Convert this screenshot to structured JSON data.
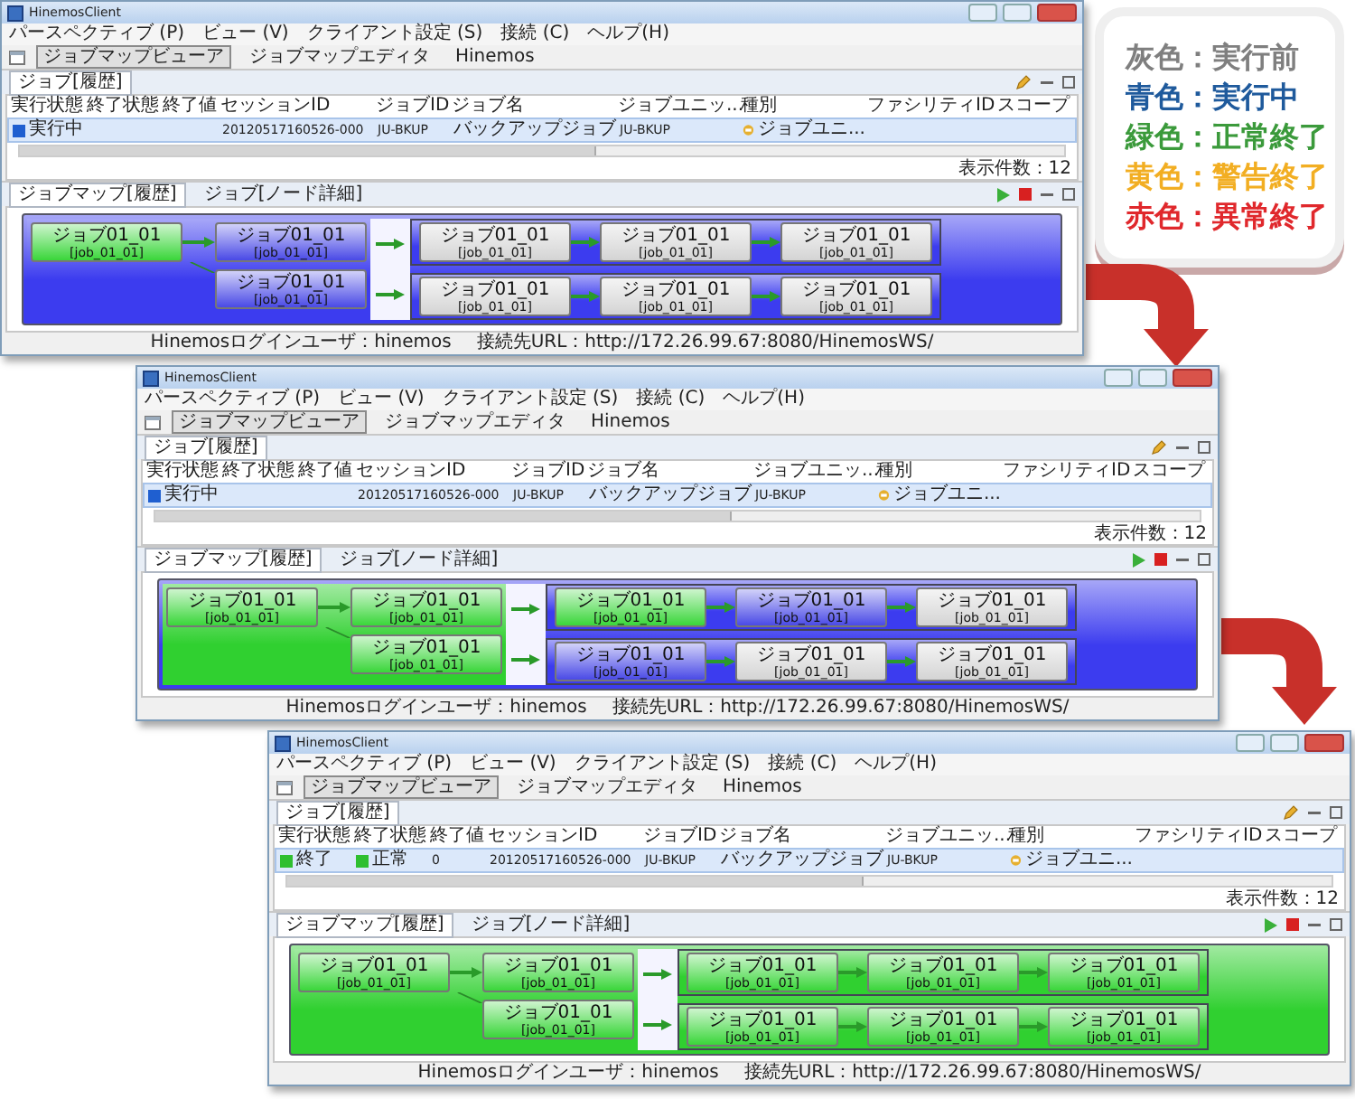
{
  "legend": [
    {
      "text": "灰色：実行前",
      "color": "#7f7f7f"
    },
    {
      "text": "青色：実行中",
      "color": "#1f5a9c"
    },
    {
      "text": "緑色：正常終了",
      "color": "#3b9a3b"
    },
    {
      "text": "黄色：警告終了",
      "color": "#f2ae22"
    },
    {
      "text": "赤色：異常終了",
      "color": "#e0282c"
    }
  ],
  "windows": [
    {
      "title": "HinemosClient",
      "menu": [
        "パースペクティブ (P)",
        "ビュー (V)",
        "クライアント設定 (S)",
        "接続 (C)",
        "ヘルプ(H)"
      ],
      "perspectives": [
        {
          "label": "ジョブマップビューア",
          "selected": true
        },
        {
          "label": "ジョブマップエディタ",
          "selected": false
        },
        {
          "label": "Hinemos",
          "selected": false
        }
      ],
      "history_tab": "ジョブ[履歴]",
      "columns": [
        "実行状態",
        "終了状態",
        "終了値",
        "セッションID",
        "ジョブID",
        "ジョブ名",
        "ジョブユニッ...",
        "種別",
        "ファシリティID",
        "スコープ"
      ],
      "row": {
        "run_state": {
          "text": "実行中",
          "color": "#1f5fd0"
        },
        "session_id": "20120517160526-000",
        "job_id": "JU-BKUP",
        "job_name": "バックアップジョブ",
        "jobunit_id": "JU-BKUP",
        "type": "ジョブユニ..."
      },
      "count": "表示件数：12",
      "map_tabs": [
        {
          "label": "ジョブマップ[履歴]",
          "selected": true
        },
        {
          "label": "ジョブ[ノード詳細]",
          "selected": false
        }
      ],
      "map": {
        "color": "#3c3cef",
        "left": {
          "color": "#3c3cef",
          "nodes": [
            {
              "label": "ジョブ01_01",
              "id": "[job_01_01]",
              "color": "#3ad63a"
            },
            {
              "label": "ジョブ01_01",
              "id": "[job_01_01]",
              "color": "#4a4ae6"
            },
            {
              "label": "ジョブ01_01",
              "id": "[job_01_01]",
              "color": "#4a4ae6"
            }
          ]
        },
        "groups": [
          {
            "color": "#3c3cef",
            "nodes": [
              {
                "label": "ジョブ01_01",
                "id": "[job_01_01]",
                "color": "#d4d4d4"
              },
              {
                "label": "ジョブ01_01",
                "id": "[job_01_01]",
                "color": "#d4d4d4"
              },
              {
                "label": "ジョブ01_01",
                "id": "[job_01_01]",
                "color": "#d4d4d4"
              }
            ]
          },
          {
            "color": "#3c3cef",
            "nodes": [
              {
                "label": "ジョブ01_01",
                "id": "[job_01_01]",
                "color": "#d4d4d4"
              },
              {
                "label": "ジョブ01_01",
                "id": "[job_01_01]",
                "color": "#d4d4d4"
              },
              {
                "label": "ジョブ01_01",
                "id": "[job_01_01]",
                "color": "#d4d4d4"
              }
            ]
          }
        ]
      },
      "status_user": "Hinemosログインユーザ：hinemos",
      "status_url": "接続先URL：http://172.26.99.67:8080/HinemosWS/"
    },
    {
      "title": "HinemosClient",
      "menu": [
        "パースペクティブ (P)",
        "ビュー (V)",
        "クライアント設定 (S)",
        "接続 (C)",
        "ヘルプ(H)"
      ],
      "perspectives": [
        {
          "label": "ジョブマップビューア",
          "selected": true
        },
        {
          "label": "ジョブマップエディタ",
          "selected": false
        },
        {
          "label": "Hinemos",
          "selected": false
        }
      ],
      "history_tab": "ジョブ[履歴]",
      "columns": [
        "実行状態",
        "終了状態",
        "終了値",
        "セッションID",
        "ジョブID",
        "ジョブ名",
        "ジョブユニッ...",
        "種別",
        "ファシリティID",
        "スコープ"
      ],
      "row": {
        "run_state": {
          "text": "実行中",
          "color": "#1f5fd0"
        },
        "session_id": "20120517160526-000",
        "job_id": "JU-BKUP",
        "job_name": "バックアップジョブ",
        "jobunit_id": "JU-BKUP",
        "type": "ジョブユニ..."
      },
      "count": "表示件数：12",
      "map_tabs": [
        {
          "label": "ジョブマップ[履歴]",
          "selected": true
        },
        {
          "label": "ジョブ[ノード詳細]",
          "selected": false
        }
      ],
      "map": {
        "color": "#3c3cef",
        "left": {
          "color": "#30d030",
          "nodes": [
            {
              "label": "ジョブ01_01",
              "id": "[job_01_01]",
              "color": "#3ad63a"
            },
            {
              "label": "ジョブ01_01",
              "id": "[job_01_01]",
              "color": "#3ad63a"
            },
            {
              "label": "ジョブ01_01",
              "id": "[job_01_01]",
              "color": "#3ad63a"
            }
          ]
        },
        "groups": [
          {
            "color": "#3c3cef",
            "nodes": [
              {
                "label": "ジョブ01_01",
                "id": "[job_01_01]",
                "color": "#3ad63a"
              },
              {
                "label": "ジョブ01_01",
                "id": "[job_01_01]",
                "color": "#4a4ae6"
              },
              {
                "label": "ジョブ01_01",
                "id": "[job_01_01]",
                "color": "#d4d4d4"
              }
            ]
          },
          {
            "color": "#3c3cef",
            "nodes": [
              {
                "label": "ジョブ01_01",
                "id": "[job_01_01]",
                "color": "#4a4ae6"
              },
              {
                "label": "ジョブ01_01",
                "id": "[job_01_01]",
                "color": "#d4d4d4"
              },
              {
                "label": "ジョブ01_01",
                "id": "[job_01_01]",
                "color": "#d4d4d4"
              }
            ]
          }
        ]
      },
      "status_user": "Hinemosログインユーザ：hinemos",
      "status_url": "接続先URL：http://172.26.99.67:8080/HinemosWS/"
    },
    {
      "title": "HinemosClient",
      "menu": [
        "パースペクティブ (P)",
        "ビュー (V)",
        "クライアント設定 (S)",
        "接続 (C)",
        "ヘルプ(H)"
      ],
      "perspectives": [
        {
          "label": "ジョブマップビューア",
          "selected": true
        },
        {
          "label": "ジョブマップエディタ",
          "selected": false
        },
        {
          "label": "Hinemos",
          "selected": false
        }
      ],
      "history_tab": "ジョブ[履歴]",
      "columns": [
        "実行状態",
        "終了状態",
        "終了値",
        "セッションID",
        "ジョブID",
        "ジョブ名",
        "ジョブユニッ...",
        "種別",
        "ファシリティID",
        "スコープ"
      ],
      "row": {
        "run_state": {
          "text": "終了",
          "color": "#2fbf2f"
        },
        "end_state": {
          "text": "正常",
          "color": "#2fbf2f"
        },
        "end_value": "0",
        "session_id": "20120517160526-000",
        "job_id": "JU-BKUP",
        "job_name": "バックアップジョブ",
        "jobunit_id": "JU-BKUP",
        "type": "ジョブユニ..."
      },
      "count": "表示件数：12",
      "map_tabs": [
        {
          "label": "ジョブマップ[履歴]",
          "selected": true
        },
        {
          "label": "ジョブ[ノード詳細]",
          "selected": false
        }
      ],
      "map": {
        "color": "#30d030",
        "left": {
          "color": "#30d030",
          "nodes": [
            {
              "label": "ジョブ01_01",
              "id": "[job_01_01]",
              "color": "#3ad63a"
            },
            {
              "label": "ジョブ01_01",
              "id": "[job_01_01]",
              "color": "#3ad63a"
            },
            {
              "label": "ジョブ01_01",
              "id": "[job_01_01]",
              "color": "#3ad63a"
            }
          ]
        },
        "groups": [
          {
            "color": "#30d030",
            "nodes": [
              {
                "label": "ジョブ01_01",
                "id": "[job_01_01]",
                "color": "#3ad63a"
              },
              {
                "label": "ジョブ01_01",
                "id": "[job_01_01]",
                "color": "#3ad63a"
              },
              {
                "label": "ジョブ01_01",
                "id": "[job_01_01]",
                "color": "#3ad63a"
              }
            ]
          },
          {
            "color": "#30d030",
            "nodes": [
              {
                "label": "ジョブ01_01",
                "id": "[job_01_01]",
                "color": "#3ad63a"
              },
              {
                "label": "ジョブ01_01",
                "id": "[job_01_01]",
                "color": "#3ad63a"
              },
              {
                "label": "ジョブ01_01",
                "id": "[job_01_01]",
                "color": "#3ad63a"
              }
            ]
          }
        ]
      },
      "status_user": "Hinemosログインユーザ：hinemos",
      "status_url": "接続先URL：http://172.26.99.67:8080/HinemosWS/"
    }
  ]
}
